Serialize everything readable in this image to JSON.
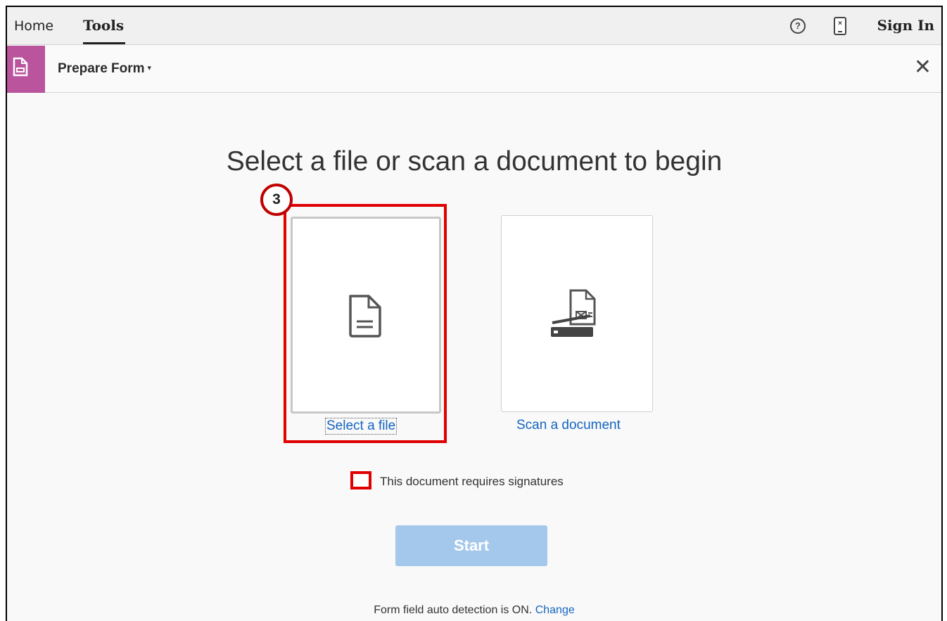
{
  "topbar": {
    "tabs": [
      {
        "label": "Home",
        "active": false
      },
      {
        "label": "Tools",
        "active": true
      }
    ],
    "icons": [
      "help-icon",
      "mobile-icon"
    ],
    "sign_in_label": "Sign In"
  },
  "toolbar": {
    "tool_name": "Prepare Form",
    "caret": "▾",
    "close_glyph": "✕",
    "badge_color": "#b9549d"
  },
  "main": {
    "heading": "Select a file or scan a document to begin",
    "step_badge": "3",
    "options": [
      {
        "label": "Select a file",
        "icon": "document-icon"
      },
      {
        "label": "Scan a document",
        "icon": "scanner-icon"
      }
    ],
    "checkbox_label": "This document requires signatures",
    "checkbox_checked": false,
    "start_label": "Start",
    "footer_text": "Form field auto detection is ON.",
    "footer_link": "Change"
  },
  "colors": {
    "highlight": "#e00000",
    "link": "#1565c0",
    "start_button": "#a4c8ec"
  }
}
